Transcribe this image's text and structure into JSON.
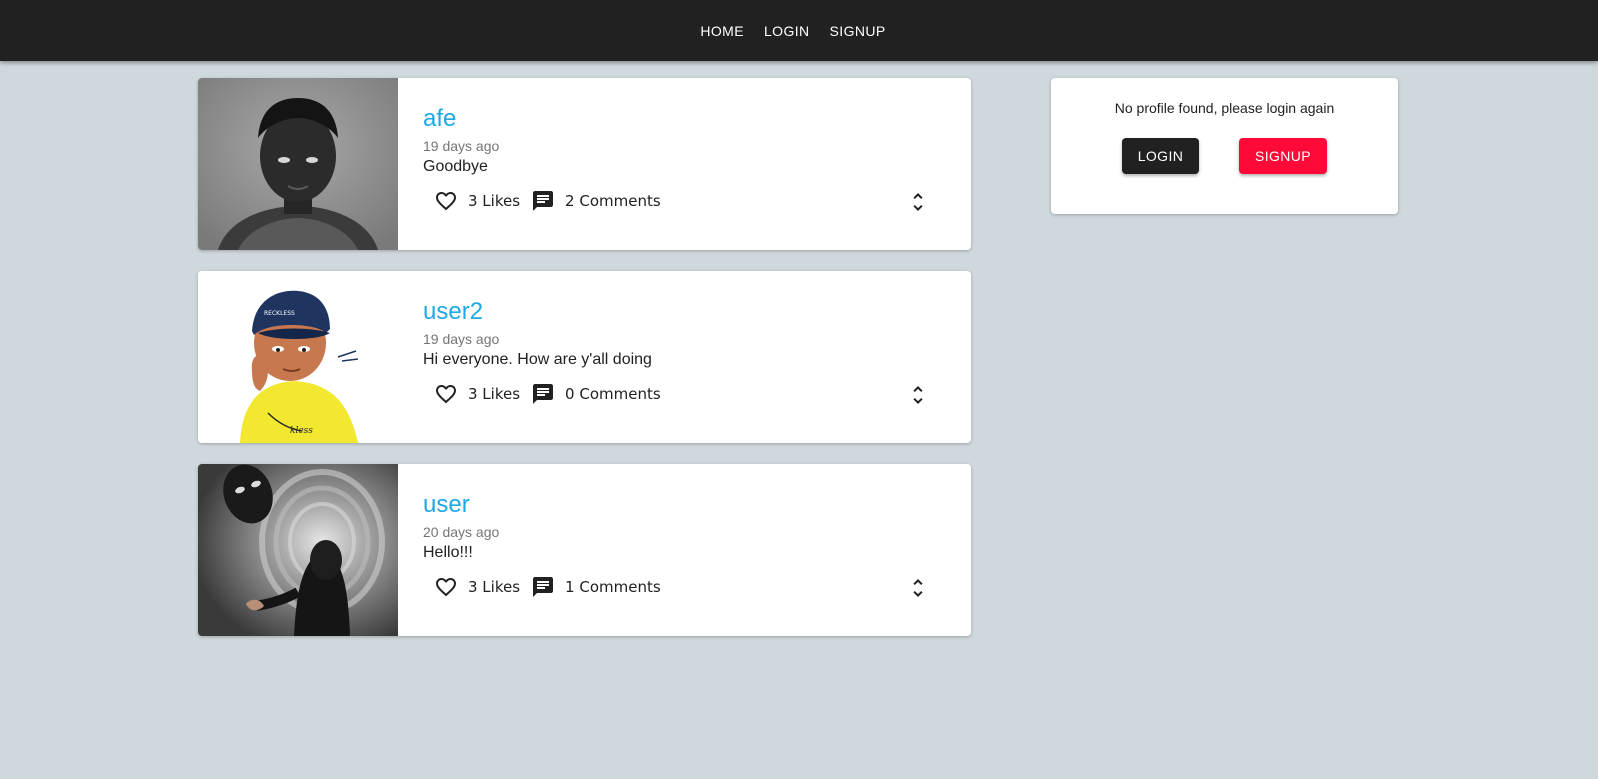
{
  "nav": {
    "items": [
      {
        "label": "HOME"
      },
      {
        "label": "LOGIN"
      },
      {
        "label": "SIGNUP"
      }
    ]
  },
  "posts": [
    {
      "handle": "afe",
      "time": "19 days ago",
      "body": "Goodbye",
      "likes": "3 Likes",
      "comments": "2 Comments"
    },
    {
      "handle": "user2",
      "time": "19 days ago",
      "body": "Hi everyone. How are y'all doing",
      "likes": "3 Likes",
      "comments": "0 Comments"
    },
    {
      "handle": "user",
      "time": "20 days ago",
      "body": "Hello!!!",
      "likes": "3 Likes",
      "comments": "1 Comments"
    }
  ],
  "profile": {
    "message": "No profile found, please login again",
    "login_label": "LOGIN",
    "signup_label": "SIGNUP"
  },
  "icons": {
    "like": "heart-outline-icon",
    "comment": "chat-icon",
    "expand": "unfold-more-icon"
  },
  "colors": {
    "navbar": "#212121",
    "background": "#cfd8dc",
    "handle": "#1da8e6",
    "signup": "#ff0a38",
    "login": "#212121"
  }
}
